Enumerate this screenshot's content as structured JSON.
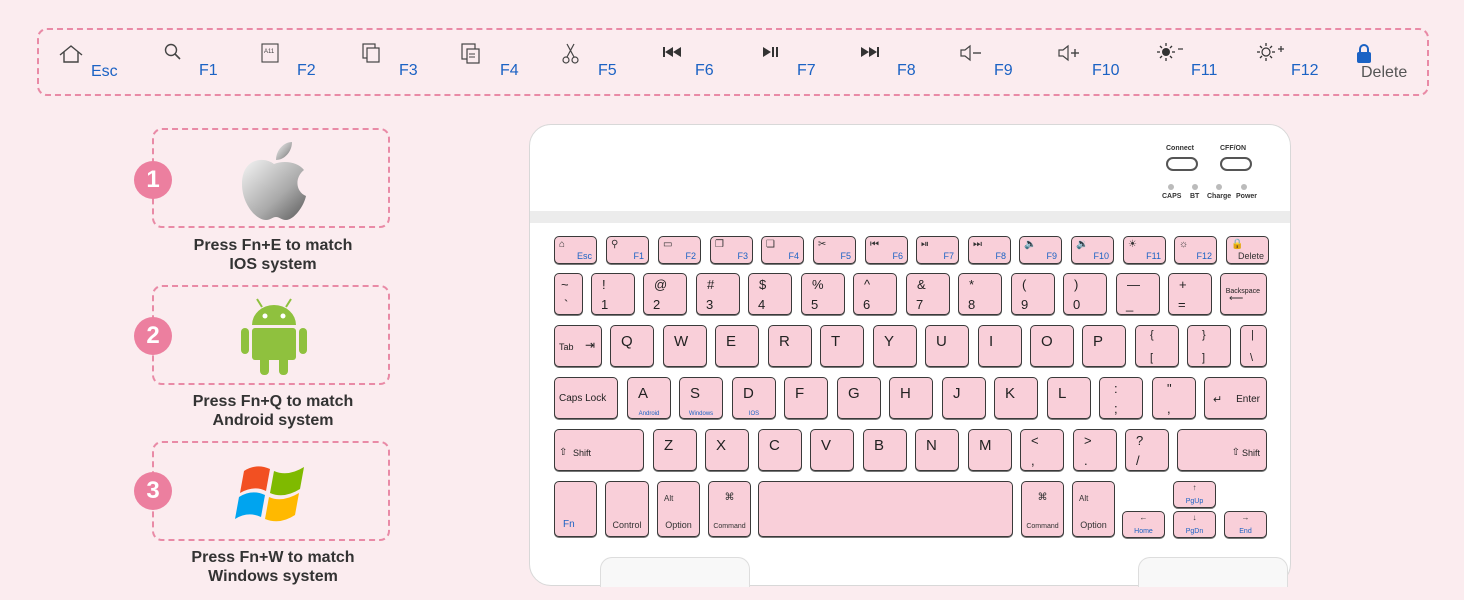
{
  "fn_bar": [
    {
      "label": "Esc",
      "icon": "home-icon"
    },
    {
      "label": "F1",
      "icon": "search-icon"
    },
    {
      "label": "F2",
      "icon": "select-all-icon"
    },
    {
      "label": "F3",
      "icon": "copy-icon"
    },
    {
      "label": "F4",
      "icon": "paste-icon"
    },
    {
      "label": "F5",
      "icon": "cut-icon"
    },
    {
      "label": "F6",
      "icon": "previous-track-icon"
    },
    {
      "label": "F7",
      "icon": "play-pause-icon"
    },
    {
      "label": "F8",
      "icon": "next-track-icon"
    },
    {
      "label": "F9",
      "icon": "volume-down-icon"
    },
    {
      "label": "F10",
      "icon": "volume-up-icon"
    },
    {
      "label": "F11",
      "icon": "brightness-down-icon"
    },
    {
      "label": "F12",
      "icon": "brightness-up-icon"
    },
    {
      "label": "Delete",
      "icon": "lock-icon"
    }
  ],
  "systems": [
    {
      "num": "1",
      "line1": "Press Fn+E to match",
      "line2": "IOS system",
      "icon": "apple-logo-icon"
    },
    {
      "num": "2",
      "line1": "Press Fn+Q to match",
      "line2": "Android system",
      "icon": "android-logo-icon"
    },
    {
      "num": "3",
      "line1": "Press Fn+W to match",
      "line2": "Windows system",
      "icon": "windows-logo-icon"
    }
  ],
  "keyboard": {
    "connect_label": "Connect",
    "power_switch_label": "CFF/ON",
    "leds": [
      "CAPS",
      "BT",
      "Charge",
      "Power"
    ],
    "fn_row": [
      "Esc",
      "F1",
      "F2",
      "F3",
      "F4",
      "F5",
      "F6",
      "F7",
      "F8",
      "F9",
      "F10",
      "F11",
      "F12",
      "Delete"
    ],
    "num_row": [
      {
        "t": "~",
        "b": "`"
      },
      {
        "t": "!",
        "b": "1"
      },
      {
        "t": "@",
        "b": "2"
      },
      {
        "t": "#",
        "b": "3"
      },
      {
        "t": "$",
        "b": "4"
      },
      {
        "t": "%",
        "b": "5"
      },
      {
        "t": "^",
        "b": "6"
      },
      {
        "t": "&",
        "b": "7"
      },
      {
        "t": "*",
        "b": "8"
      },
      {
        "t": "(",
        "b": "9"
      },
      {
        "t": ")",
        "b": "0"
      },
      {
        "t": "—",
        "b": "_"
      },
      {
        "t": "+",
        "b": "="
      }
    ],
    "backspace": "Backspace",
    "tab": "Tab",
    "q_row": [
      "Q",
      "W",
      "E",
      "R",
      "T",
      "Y",
      "U",
      "I",
      "O",
      "P"
    ],
    "q_row_extra": [
      {
        "t": "{",
        "b": "["
      },
      {
        "t": "}",
        "b": "]"
      },
      {
        "t": "|",
        "b": "\\"
      }
    ],
    "caps": "Caps Lock",
    "a_row": [
      {
        "k": "A",
        "s": "Android"
      },
      {
        "k": "S",
        "s": "Windows"
      },
      {
        "k": "D",
        "s": "IOS"
      },
      {
        "k": "F",
        "s": ""
      },
      {
        "k": "G",
        "s": ""
      },
      {
        "k": "H",
        "s": ""
      },
      {
        "k": "J",
        "s": ""
      },
      {
        "k": "K",
        "s": ""
      },
      {
        "k": "L",
        "s": ""
      }
    ],
    "a_row_extra": [
      {
        "t": ":",
        "b": ";"
      },
      {
        "t": "\"",
        "b": ","
      }
    ],
    "enter": "Enter",
    "shift": "Shift",
    "z_row": [
      "Z",
      "X",
      "C",
      "V",
      "B",
      "N",
      "M"
    ],
    "z_row_extra": [
      {
        "t": "<",
        "b": ","
      },
      {
        "t": ">",
        "b": "."
      },
      {
        "t": "?",
        "b": "/"
      }
    ],
    "fn": "Fn",
    "control": "Control",
    "alt": "Alt",
    "option": "Option",
    "cmd_symbol": "⌘",
    "command": "Command",
    "pgup": "PgUp",
    "pgdn": "PgDn",
    "home": "Home",
    "end": "End"
  }
}
